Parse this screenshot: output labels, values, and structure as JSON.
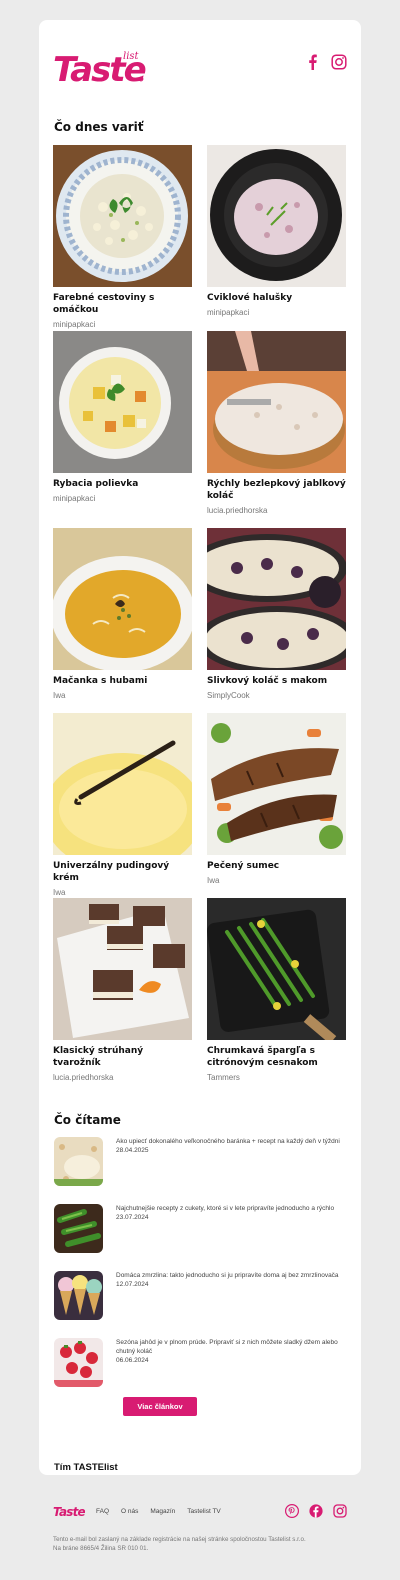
{
  "brand": {
    "name": "Taste",
    "suffix": "list",
    "accent_color": "#d81b72"
  },
  "header": {
    "social": [
      {
        "name": "facebook-icon"
      },
      {
        "name": "instagram-icon"
      }
    ]
  },
  "recipes_section": {
    "title": "Čo dnes variť",
    "items": [
      {
        "title": "Farebné cestoviny s omáčkou",
        "author": "minipapkaci"
      },
      {
        "title": "Cviklové halušky",
        "author": "minipapkaci"
      },
      {
        "title": "Rybacia polievka",
        "author": "minipapkaci"
      },
      {
        "title": "Rýchly bezlepkový jablkový koláč",
        "author": "lucia.priedhorska"
      },
      {
        "title": "Mačanka s hubami",
        "author": "Iwa"
      },
      {
        "title": "Slivkový koláč s makom",
        "author": "SimplyCook"
      },
      {
        "title": "Univerzálny pudingový krém",
        "author": "Iwa"
      },
      {
        "title": "Pečený sumec",
        "author": "Iwa"
      },
      {
        "title": "Klasický strúhaný tvarožník",
        "author": "lucia.priedhorska"
      },
      {
        "title": "Chrumkavá špargľa s citrónovým cesnakom",
        "author": "Tammers"
      }
    ]
  },
  "reading_section": {
    "title": "Čo čítame",
    "articles": [
      {
        "title": "Ako upiecť dokonalého veľkonočného baránka + recept na každý deň v týždni",
        "date": "28.04.2025"
      },
      {
        "title": "Najchutnejšie recepty z cukety, ktoré si v lete pripravíte jednoducho a rýchlo",
        "date": "23.07.2024"
      },
      {
        "title": "Domáca zmrzlina: takto jednoducho si ju pripravíte doma aj bez zmrzlinovača",
        "date": "12.07.2024"
      },
      {
        "title": "Sezóna jahôd je v plnom prúde. Pripraviť si z nich môžete sladký džem alebo chutný koláč",
        "date": "06.06.2024"
      }
    ],
    "more_button": "Viac článkov"
  },
  "signature": "Tím TASTElist",
  "footer": {
    "nav": [
      "FAQ",
      "O nás",
      "Magazín",
      "Tastelist TV"
    ],
    "note": "Tento e-mail bol zaslaný na základe registrácie na našej stránke spoločnostou Tastelist s.r.o. Na bráne 8665/4 Žilina SR 010 01."
  }
}
